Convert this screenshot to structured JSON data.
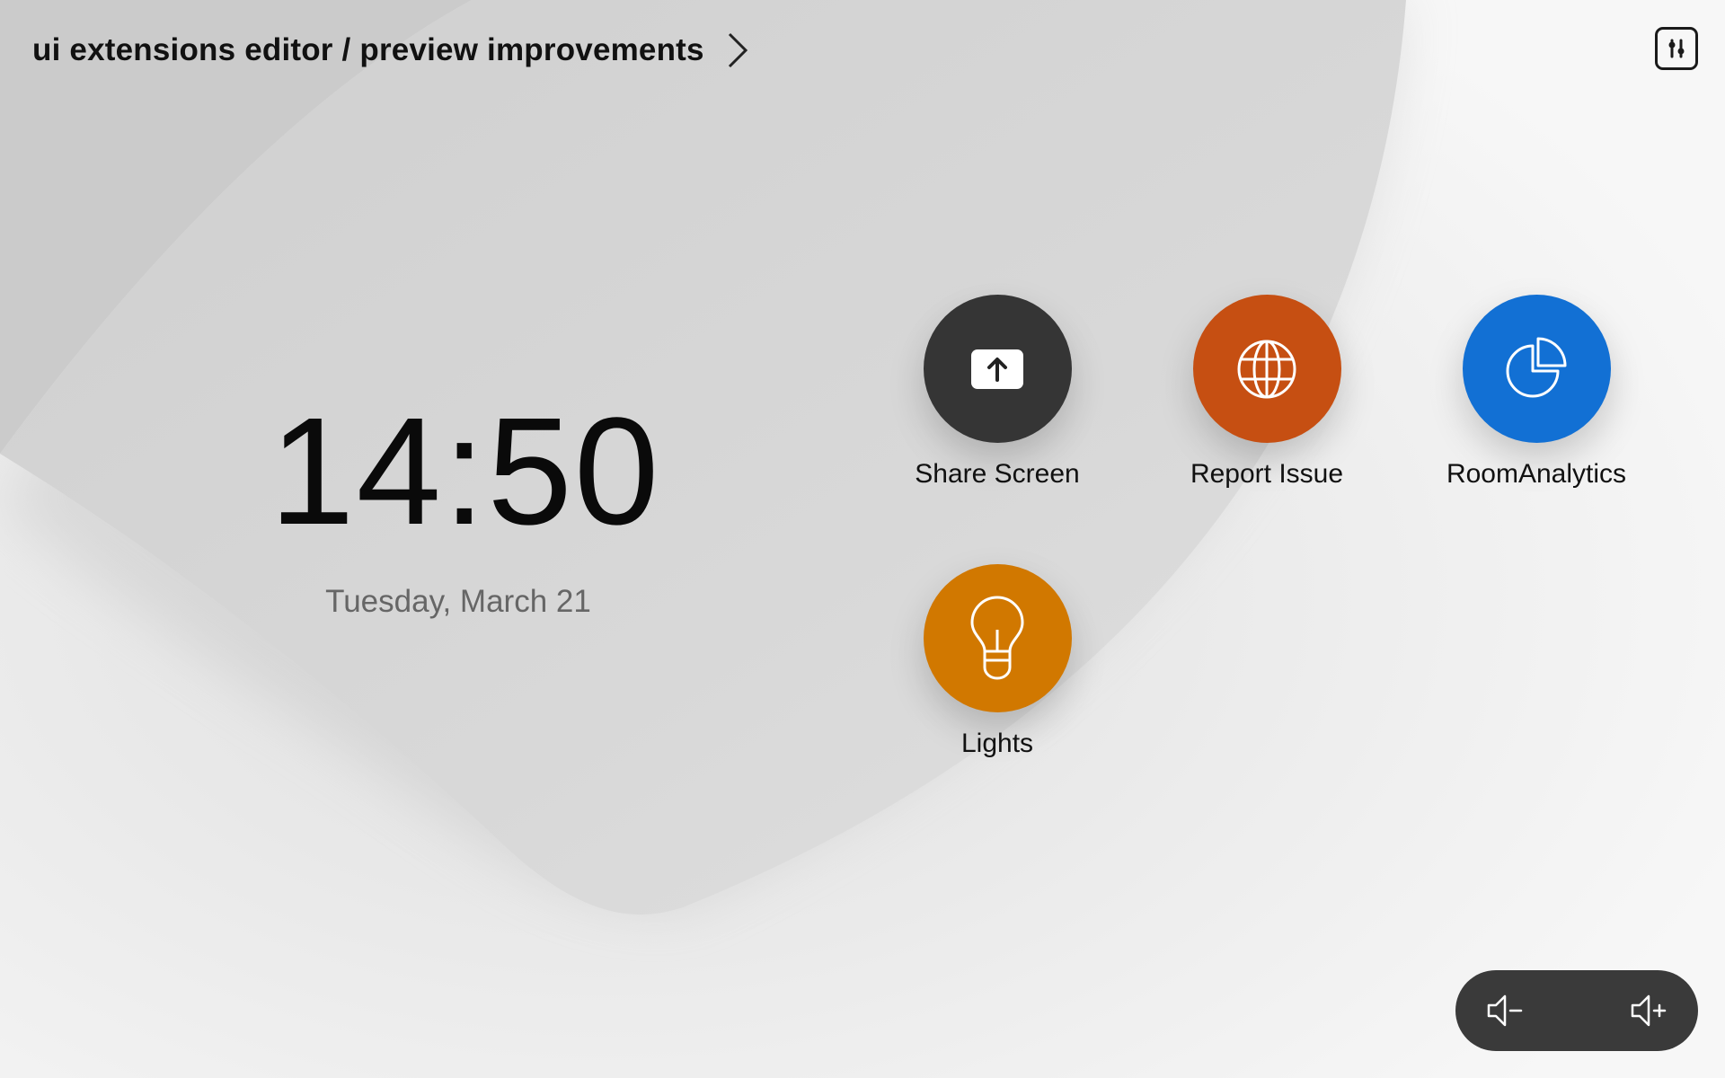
{
  "header": {
    "title": "ui extensions editor / preview improvements",
    "chevron_icon": "chevron-right-icon",
    "settings_icon": "control-panel-icon"
  },
  "clock": {
    "time": "14:50",
    "date": "Tuesday, March 21"
  },
  "tiles": [
    {
      "label": "Share Screen",
      "icon": "share-screen-icon",
      "color": "#353535"
    },
    {
      "label": "Report Issue",
      "icon": "globe-icon",
      "color": "#c64f12"
    },
    {
      "label": "RoomAnalytics",
      "icon": "pie-chart-icon",
      "color": "#1270d4"
    },
    {
      "label": "Lights",
      "icon": "lightbulb-icon",
      "color": "#d17800"
    }
  ],
  "volume": {
    "down_icon": "volume-down-icon",
    "up_icon": "volume-up-icon",
    "background": "#3a3a3a"
  }
}
